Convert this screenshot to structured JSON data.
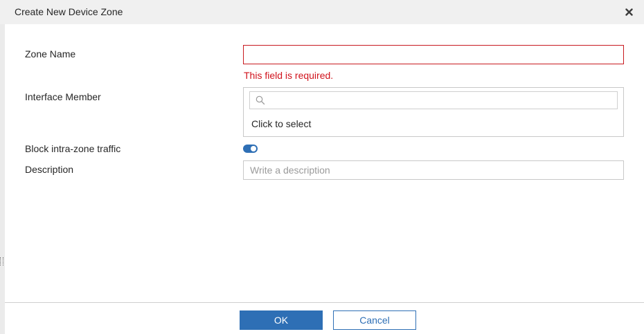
{
  "dialog": {
    "title": "Create New Device Zone",
    "close_icon": "close-icon"
  },
  "form": {
    "zone_name": {
      "label": "Zone Name",
      "value": "",
      "error": "This field is required."
    },
    "interface_member": {
      "label": "Interface Member",
      "search_icon": "search-icon",
      "search_value": "",
      "select_text": "Click to select"
    },
    "block_intra_zone": {
      "label": "Block intra-zone traffic",
      "enabled": true
    },
    "description": {
      "label": "Description",
      "placeholder": "Write a description",
      "value": ""
    }
  },
  "footer": {
    "ok_label": "OK",
    "cancel_label": "Cancel"
  },
  "colors": {
    "accent": "#2e6fb5",
    "error": "#d0111b",
    "title_bar": "#f0f0f0"
  }
}
